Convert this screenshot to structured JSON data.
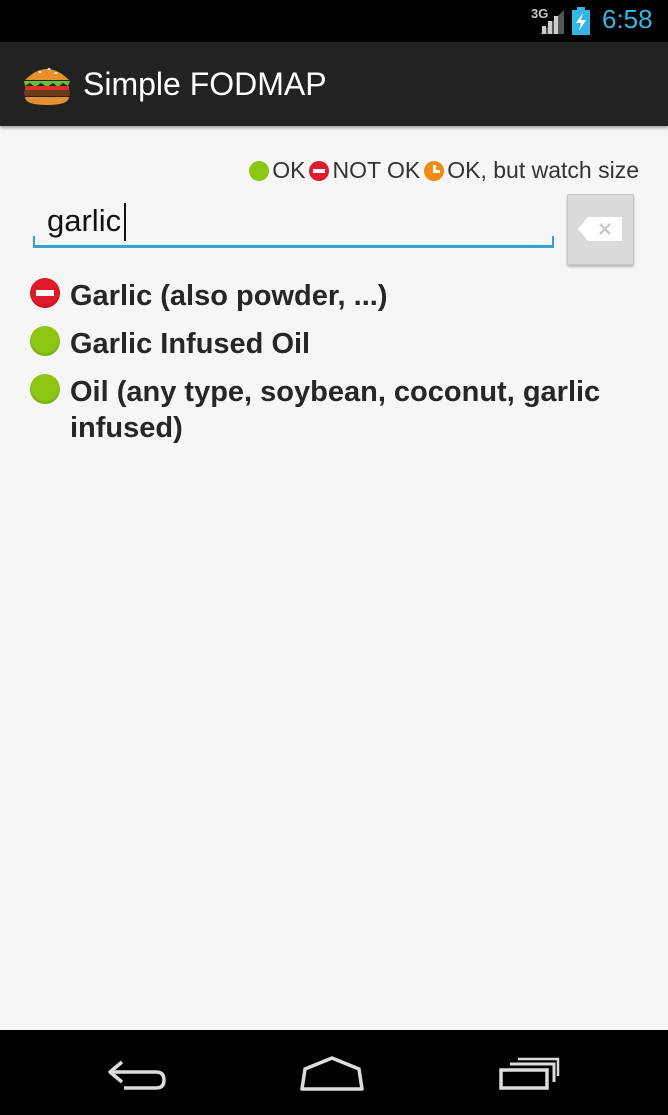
{
  "status_bar": {
    "network_label": "3G",
    "clock": "6:58",
    "colors": {
      "clock": "#33b5e5"
    }
  },
  "app_bar": {
    "icon": "hamburger-burger-icon",
    "title": "Simple FODMAP"
  },
  "legend": {
    "ok_label": "OK",
    "not_ok_label": "NOT OK",
    "watch_label": "OK, but watch size",
    "colors": {
      "ok": "#8cc512",
      "not_ok": "#e01a2a",
      "watch": "#f08a14"
    }
  },
  "search": {
    "value": "garlic",
    "clear_icon": "backspace-clear-icon",
    "accent": "#33a3d3"
  },
  "results": [
    {
      "status": "not_ok",
      "label": "Garlic (also powder, ...)"
    },
    {
      "status": "ok",
      "label": "Garlic Infused Oil"
    },
    {
      "status": "ok",
      "label": "Oil (any type, soybean, coconut, garlic infused)"
    }
  ],
  "nav_bar": {
    "back_icon": "back-arrow-icon",
    "home_icon": "home-icon",
    "recents_icon": "recent-apps-icon"
  }
}
